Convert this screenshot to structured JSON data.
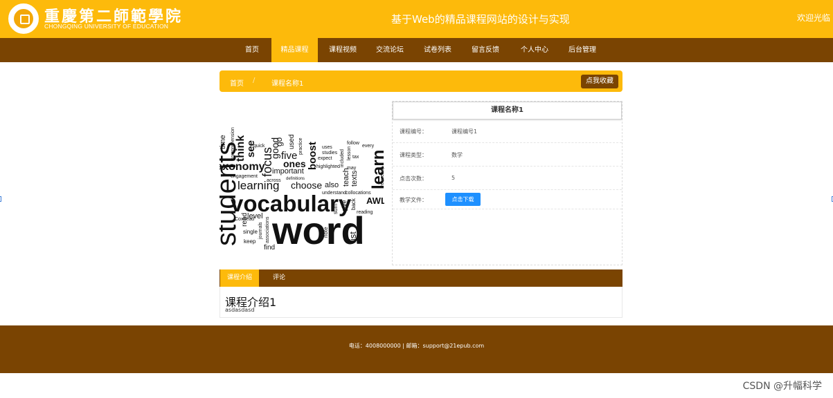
{
  "header": {
    "school_name_cn": "重慶第二師範學院",
    "school_name_en": "CHONGQING UNIVERSITY OF EDUCATION",
    "site_title": "基于Web的精品课程网站的设计与实现",
    "welcome": "欢迎光临",
    "brand_color": "#FDBA0B"
  },
  "nav": {
    "items": [
      {
        "label": "首页"
      },
      {
        "label": "精品课程"
      },
      {
        "label": "课程视频"
      },
      {
        "label": "交流论坛"
      },
      {
        "label": "试卷列表"
      },
      {
        "label": "留言反馈"
      },
      {
        "label": "个人中心"
      },
      {
        "label": "后台管理"
      }
    ],
    "active": "精品课程",
    "background": "#7A4402"
  },
  "breadcrumb": {
    "home": "首页",
    "separator": "/",
    "current": "课程名称1",
    "favorite_button": "点我收藏"
  },
  "wordcloud": {
    "words": [
      "students",
      "vocabulary",
      "word",
      "learning",
      "focus",
      "learn",
      "choose",
      "important",
      "five",
      "ones",
      "think",
      "see",
      "good",
      "boost",
      "teach",
      "also",
      "taxonomy",
      "level",
      "read",
      "find",
      "keep",
      "single",
      "reading",
      "give",
      "note",
      "list",
      "sum",
      "practice",
      "quick",
      "expect",
      "uses",
      "studies",
      "follow",
      "every",
      "tax",
      "lesson",
      "highlighted",
      "understand",
      "collocations",
      "engagement",
      "across",
      "definitions",
      "AWL",
      "Coxhead",
      "may",
      "texts",
      "frequently",
      "journals",
      "associations",
      "time",
      "comprehension",
      "used",
      "included",
      "go",
      "back"
    ]
  },
  "course": {
    "title": "课程名称1",
    "fields": [
      {
        "label": "课程编号：",
        "value": "课程编号1"
      },
      {
        "label": "课程类型：",
        "value": "数学"
      },
      {
        "label": "点击次数：",
        "value": "5"
      },
      {
        "label": "教学文件：",
        "value": ""
      }
    ],
    "download_button": "点击下载"
  },
  "tabs": {
    "items": [
      {
        "label": "课程介绍"
      },
      {
        "label": "评论"
      }
    ],
    "active": "课程介绍"
  },
  "intro": {
    "heading": "课程介绍1",
    "text": "asdasdasd"
  },
  "footer": {
    "text": "电话：4008000000 | 邮箱：support@21epub.com"
  },
  "watermark": "CSDN @升幅科学"
}
